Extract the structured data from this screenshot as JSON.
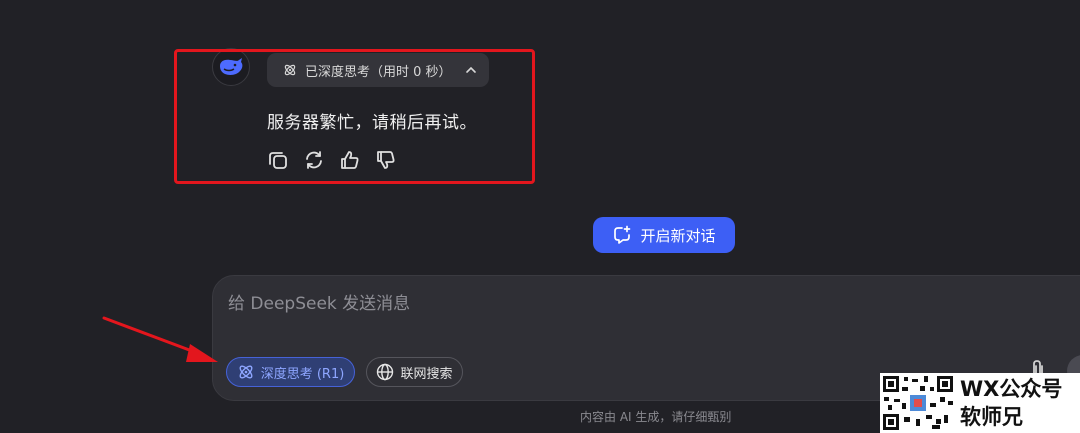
{
  "chat": {
    "thinking_chip_label": "已深度思考（用时 0 秒）",
    "reply_text": "服务器繁忙，请稍后再试。",
    "actions": [
      "copy-icon",
      "regenerate-icon",
      "thumbs-up-icon",
      "thumbs-down-icon"
    ]
  },
  "new_chat_label": "开启新对话",
  "composer": {
    "placeholder": "给 DeepSeek 发送消息",
    "deep_think_label": "深度思考 (R1)",
    "web_search_label": "联网搜索"
  },
  "disclaimer": "内容由 AI 生成，请仔细甄别",
  "watermark": {
    "line1": "WX公众号",
    "line2": "软师兄"
  },
  "colors": {
    "background": "#212126",
    "accent": "#3d5ff5",
    "highlight": "#e3161d",
    "deep_think_text": "#8ea6ff"
  }
}
